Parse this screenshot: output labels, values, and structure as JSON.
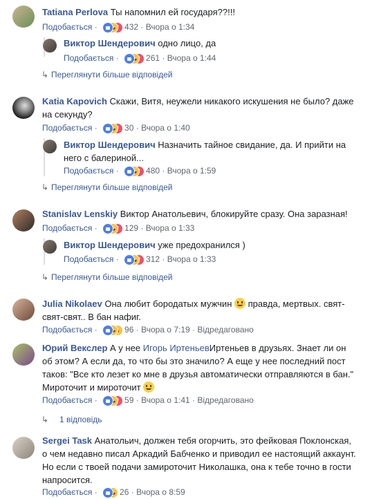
{
  "labels": {
    "like": "Подобається",
    "dot": "·",
    "more_replies": "Переглянути більше відповідей"
  },
  "comments": [
    {
      "name": "Tatiana Perlova",
      "text": "Ты напомнил ей государя??!!!",
      "count": "432",
      "time": "Вчора о 1:34"
    },
    {
      "name": "Виктор Шендерович",
      "text": "одно лицо, да",
      "count": "261",
      "time": "Вчора о 1:44"
    },
    {
      "name": "Katia Kapovich",
      "text": "Скажи, Витя, неужели никакого искушения не было? даже",
      "text2": "на секунду?",
      "count": "30",
      "time": "Вчора о 1:40"
    },
    {
      "name": "Виктор Шендерович",
      "text": "Назначить тайное свидание, да. И прийти на",
      "text2": "него с балериной...",
      "count": "480",
      "time": "Вчора о 1:59"
    },
    {
      "name": "Stanislav Lenskiy",
      "text": "Виктор Анатольевич, блокируйте сразу. Она заразная!",
      "count": "129",
      "time": "Вчора о 1:33"
    },
    {
      "name": "Виктор Шендерович",
      "text": "уже предохранился )",
      "count": "312",
      "time": "Вчора о 1:33"
    },
    {
      "name": "Julia Nikolaev",
      "text": "Она любит бородатых мужчин",
      "text_b": "правда, мертвых. свят-",
      "text2": "свят-свят.. В бан нафиг.",
      "count": "96",
      "time": "Вчора о 7:19",
      "edited": "Відредаговано"
    },
    {
      "name": "Юрий Векслер",
      "text": "А у нее",
      "mention": "Игорь Иртеньев",
      "text_b": "Иртеньев в друзьях. Знает ли он",
      "text2": "об этом? А если да, то что бы это значило? А еще у нее последний пост",
      "text3": "таков: \"Все кто лезет ко мне в друзья автоматически отправляются в бан.\"",
      "text4": "Мироточит и мироточит",
      "count": "59",
      "time": "Вчора о 1:41",
      "edited": "Відредаговано",
      "replies": "1 відповідь"
    },
    {
      "name": "Sergei Task",
      "text": "Анатольич, должен тебя огорчить, это фейковая Поклонская,",
      "text2": "о чем недавно писал Аркадий Бабченко и приводил ее настоящий аккаунт.",
      "text3": "Но если с твоей подачи замироточит Николашка, она к тебе точно в гости",
      "text4": "напросится.",
      "count": "26",
      "time": "Вчора о 8:59"
    }
  ]
}
